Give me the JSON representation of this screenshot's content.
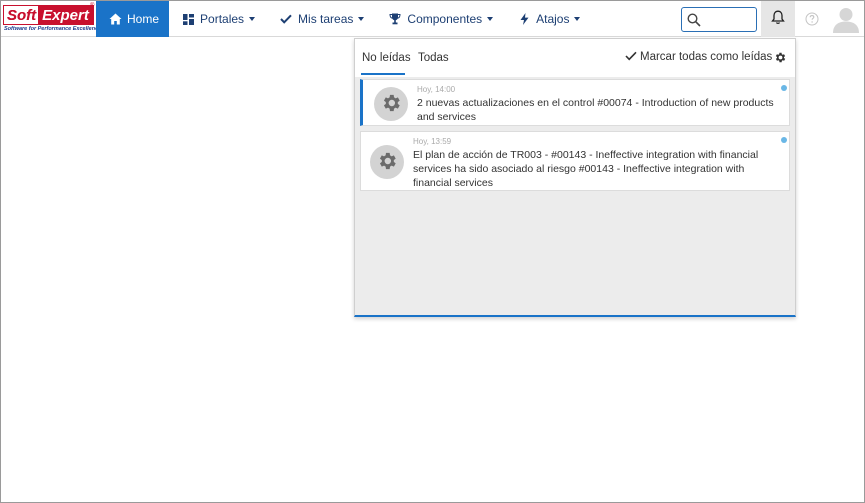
{
  "brand": {
    "name_part1": "Soft",
    "name_part2": "Expert",
    "registered": "®",
    "tagline": "Software for Performance Excellence",
    "red": "#c8102e",
    "blue": "#1b3a8c"
  },
  "nav": {
    "items": [
      {
        "label": "Home",
        "icon": "home-icon",
        "active": true
      },
      {
        "label": "Portales",
        "icon": "dashboard-icon",
        "dropdown": true
      },
      {
        "label": "Mis tareas",
        "icon": "check-icon",
        "dropdown": true
      },
      {
        "label": "Componentes",
        "icon": "trophy-icon",
        "dropdown": true
      },
      {
        "label": "Atajos",
        "icon": "bolt-icon",
        "dropdown": true
      }
    ],
    "accent": "#1a73c8"
  },
  "search": {
    "value": "",
    "icon": "search-icon"
  },
  "notifications": {
    "tabs": [
      {
        "label": "No leídas",
        "selected": true
      },
      {
        "label": "Todas",
        "selected": false
      }
    ],
    "mark_all_label": "Marcar todas como leídas",
    "items": [
      {
        "time": "Hoy, 14:00",
        "text": "2 nuevas actualizaciones en el control #00074 - Introduction of new products and services",
        "icon": "gear-icon",
        "unread": true
      },
      {
        "time": "Hoy, 13:59",
        "text": "El plan de acción de TR003 - #00143 - Ineffective integration with financial services ha sido asociado al riesgo #00143 - Ineffective integration with financial services",
        "icon": "gear-icon",
        "unread": true
      }
    ],
    "unread_dot_color": "#6ab7e6"
  }
}
